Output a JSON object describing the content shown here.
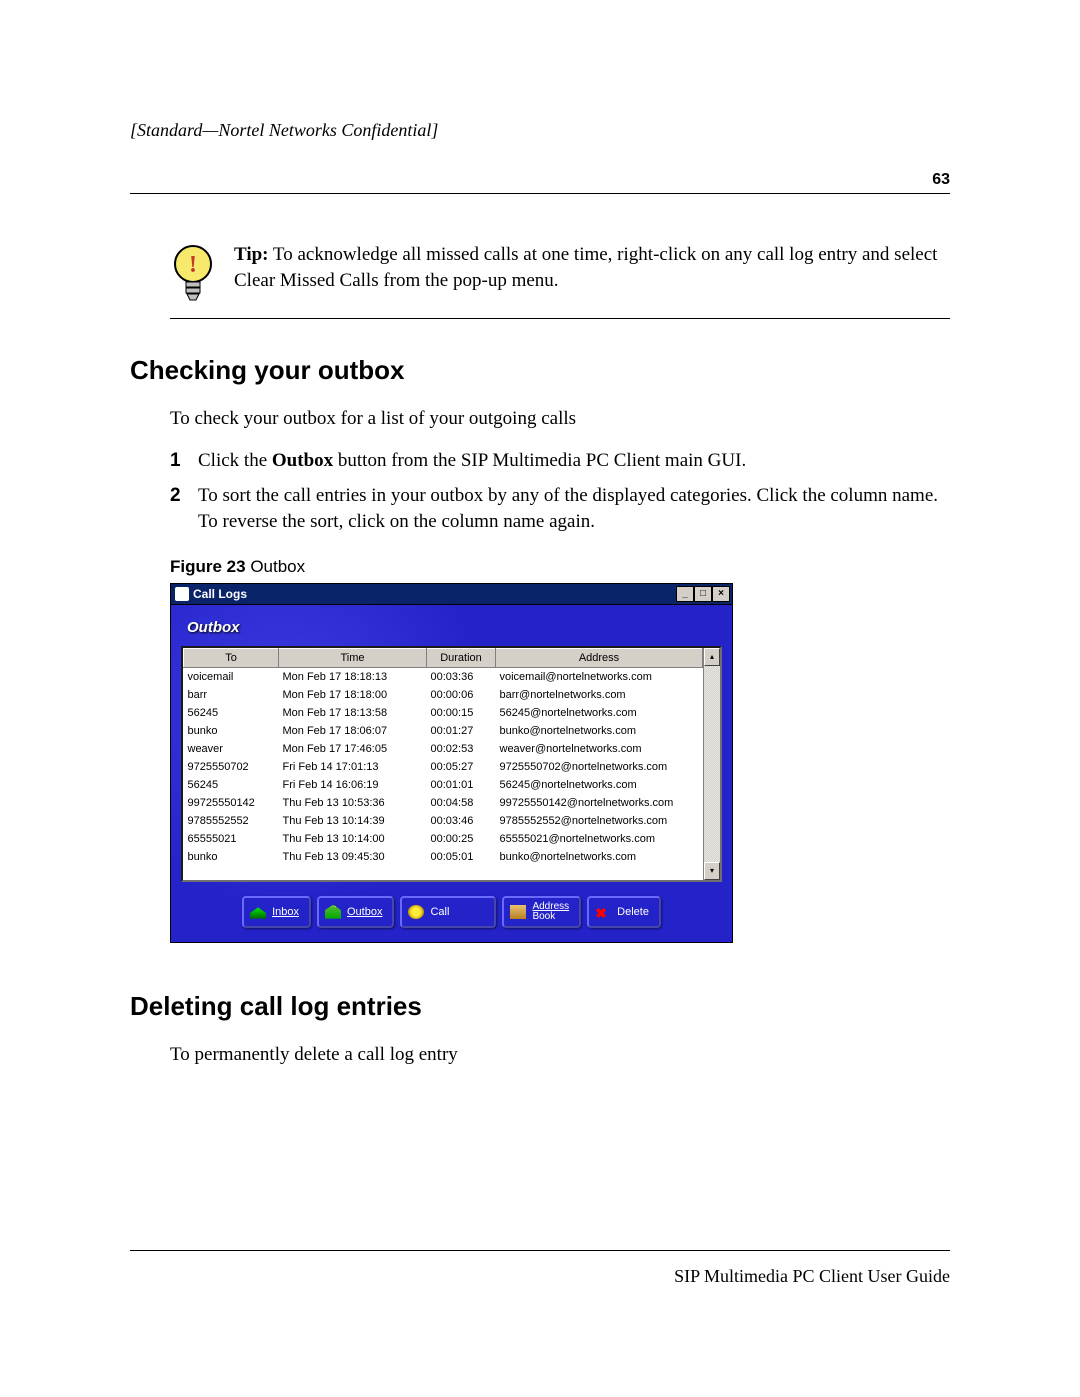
{
  "header": {
    "confidential": "[Standard—Nortel Networks Confidential]",
    "page_number": "63"
  },
  "tip": {
    "label": "Tip:",
    "text": " To acknowledge all missed calls at one time, right-click on any call log entry and select Clear Missed Calls from the pop-up menu."
  },
  "section_outbox": {
    "heading": "Checking your outbox",
    "intro": "To check your outbox for a list of your outgoing calls",
    "step1_num": "1",
    "step1_pre": "Click the ",
    "step1_bold": "Outbox",
    "step1_post": " button from the SIP Multimedia PC Client main GUI.",
    "step2_num": "2",
    "step2": "To sort the call entries in your outbox by any of the displayed categories. Click the column name. To reverse the sort, click on the column name again."
  },
  "figure": {
    "label": "Figure 23",
    "caption": "   Outbox"
  },
  "calllogs": {
    "title": "Call Logs",
    "section": "Outbox",
    "columns": {
      "to": "To",
      "time": "Time",
      "duration": "Duration",
      "address": "Address"
    },
    "rows": [
      {
        "to": "voicemail",
        "time": "Mon Feb 17 18:18:13",
        "duration": "00:03:36",
        "address": "voicemail@nortelnetworks.com"
      },
      {
        "to": "barr",
        "time": "Mon Feb 17 18:18:00",
        "duration": "00:00:06",
        "address": "barr@nortelnetworks.com"
      },
      {
        "to": "56245",
        "time": "Mon Feb 17 18:13:58",
        "duration": "00:00:15",
        "address": "56245@nortelnetworks.com"
      },
      {
        "to": "bunko",
        "time": "Mon Feb 17 18:06:07",
        "duration": "00:01:27",
        "address": "bunko@nortelnetworks.com"
      },
      {
        "to": "weaver",
        "time": "Mon Feb 17 17:46:05",
        "duration": "00:02:53",
        "address": "weaver@nortelnetworks.com"
      },
      {
        "to": "9725550702",
        "time": "Fri Feb 14 17:01:13",
        "duration": "00:05:27",
        "address": "9725550702@nortelnetworks.com"
      },
      {
        "to": "56245",
        "time": "Fri Feb 14 16:06:19",
        "duration": "00:01:01",
        "address": "56245@nortelnetworks.com"
      },
      {
        "to": "99725550142",
        "time": "Thu Feb 13 10:53:36",
        "duration": "00:04:58",
        "address": "99725550142@nortelnetworks.com"
      },
      {
        "to": "9785552552",
        "time": "Thu Feb 13 10:14:39",
        "duration": "00:03:46",
        "address": "9785552552@nortelnetworks.com"
      },
      {
        "to": "65555021",
        "time": "Thu Feb 13 10:14:00",
        "duration": "00:00:25",
        "address": "65555021@nortelnetworks.com"
      },
      {
        "to": "bunko",
        "time": "Thu Feb 13 09:45:30",
        "duration": "00:05:01",
        "address": "bunko@nortelnetworks.com"
      }
    ],
    "buttons": {
      "inbox": "Inbox",
      "outbox": "Outbox",
      "call": "Call",
      "address_l1": "Address",
      "address_l2": "Book",
      "delete": "Delete"
    }
  },
  "section_delete": {
    "heading": "Deleting call log entries",
    "intro": "To permanently delete a call log entry"
  },
  "footer": "SIP Multimedia PC Client User Guide"
}
